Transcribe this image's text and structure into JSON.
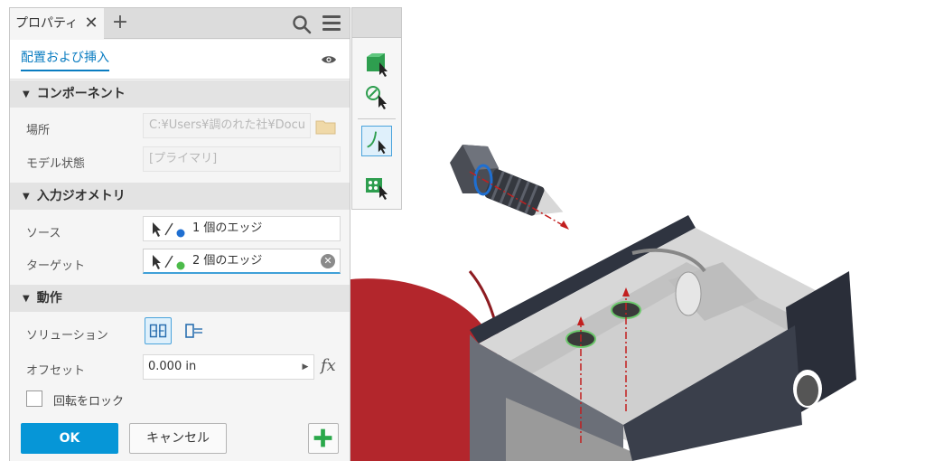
{
  "panel": {
    "tab_label": "プロパティ",
    "tab_close_icon": "close-icon",
    "tab_add_icon": "plus-icon",
    "search_icon": "search-icon",
    "menu_icon": "hamburger-menu-icon",
    "subtab_label": "配置および挿入",
    "visibility_icon": "eye-icon"
  },
  "component_section": {
    "title": "コンポーネント",
    "location_label": "場所",
    "location_value": "C:¥Users¥調のれた社¥Docu",
    "model_state_label": "モデル状態",
    "model_state_value": "[プライマリ]"
  },
  "geometry_section": {
    "title": "入力ジオメトリ",
    "source_label": "ソース",
    "source_value": "1 個のエッジ",
    "target_label": "ターゲット",
    "target_value": "2 個のエッジ"
  },
  "action_section": {
    "title": "動作",
    "solution_label": "ソリューション",
    "offset_label": "オフセット",
    "offset_value": "0.000 in",
    "fx_label": "fx",
    "lock_rotation_label": "回転をロック",
    "lock_rotation_checked": false
  },
  "buttons": {
    "ok": "OK",
    "cancel": "キャンセル"
  },
  "colors": {
    "accent": "#0696d7",
    "source_dot": "#1f6fd1",
    "target_dot": "#4cbb4a",
    "plus_green": "#2aa84a"
  }
}
